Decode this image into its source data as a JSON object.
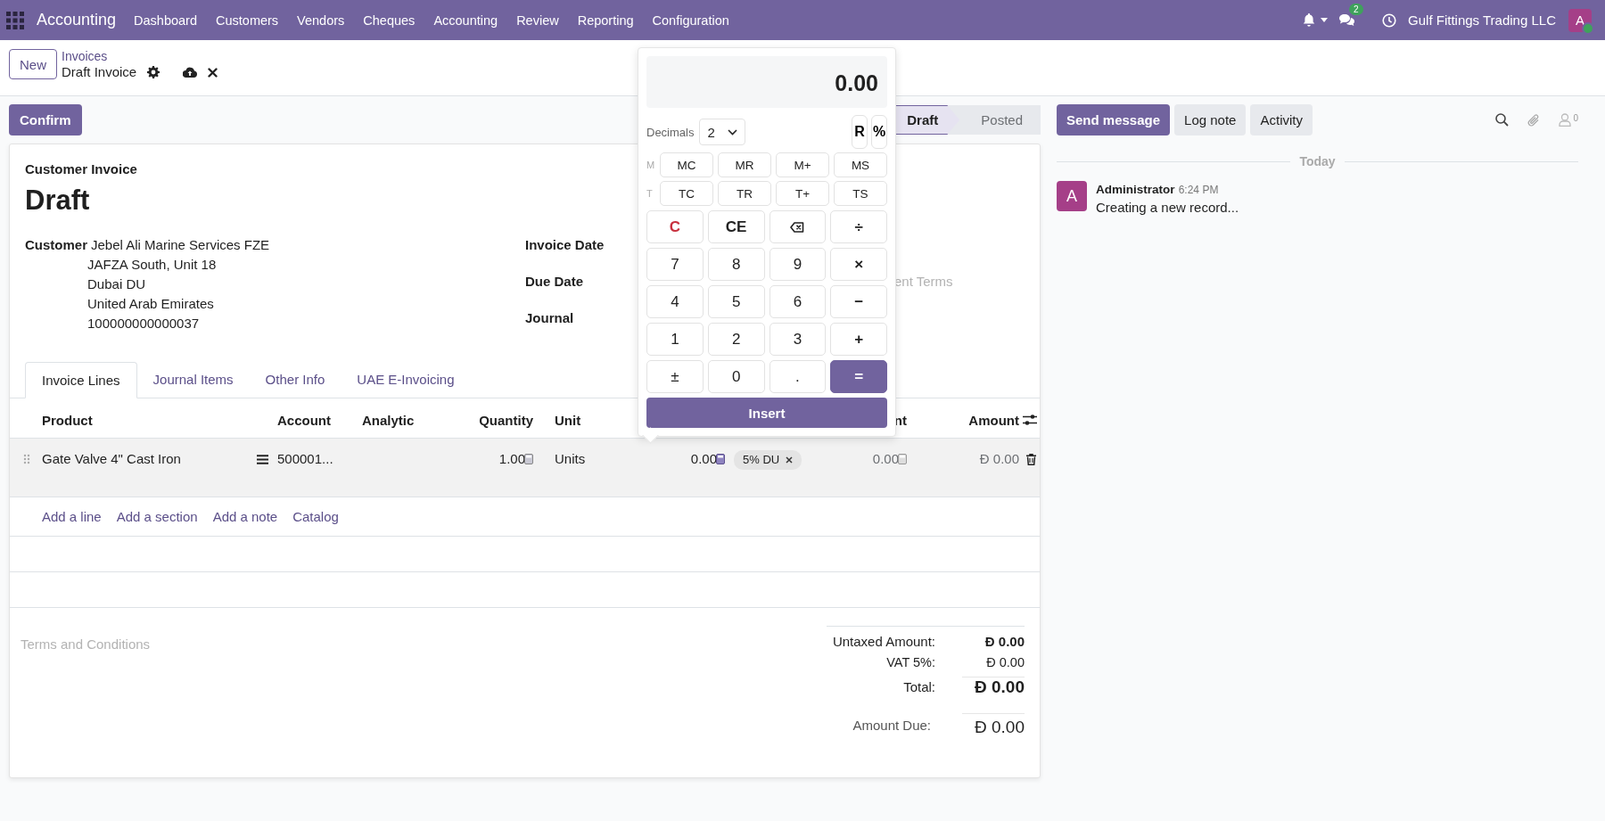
{
  "navbar": {
    "app_name": "Accounting",
    "menu": [
      "Dashboard",
      "Customers",
      "Vendors",
      "Cheques",
      "Accounting",
      "Review",
      "Reporting",
      "Configuration"
    ],
    "messages_count": "2",
    "company": "Gulf Fittings Trading LLC",
    "avatar_letter": "A"
  },
  "control_panel": {
    "new_button": "New",
    "breadcrumb": "Invoices",
    "record_title": "Draft Invoice"
  },
  "confirm_button": "Confirm",
  "status_steps": [
    {
      "label": "Draft",
      "selected": true
    },
    {
      "label": "Posted",
      "selected": false
    }
  ],
  "form": {
    "type_label": "Customer Invoice",
    "name": "Draft",
    "customer_label": "Customer",
    "customer_name": "Jebel Ali Marine Services FZE",
    "customer_address": [
      "JAFZA South, Unit 18",
      "Dubai DU",
      "United Arab Emirates",
      "100000000000037"
    ],
    "invoice_date_label": "Invoice Date",
    "due_date_label": "Due Date",
    "payment_terms_placeholder": "ent Terms",
    "journal_label": "Journal"
  },
  "tabs": [
    {
      "label": "Invoice Lines",
      "selected": true
    },
    {
      "label": "Journal Items",
      "selected": false
    },
    {
      "label": "Other Info",
      "selected": false
    },
    {
      "label": "UAE E-Invoicing",
      "selected": false
    }
  ],
  "table": {
    "columns": [
      "Product",
      "Account",
      "Analytic",
      "Quantity",
      "Unit",
      "nt",
      "Amount"
    ],
    "rows": [
      {
        "product": "Gate Valve 4\" Cast Iron",
        "account": "500001...",
        "quantity": "1.00",
        "unit": "Units",
        "price": "0.00",
        "tax": "5% DU",
        "discount": "0.00",
        "amount": "Đ 0.00"
      }
    ],
    "add_links": [
      "Add a line",
      "Add a section",
      "Add a note",
      "Catalog"
    ]
  },
  "terms_placeholder": "Terms and Conditions",
  "totals": [
    {
      "label": "Untaxed Amount:",
      "value": "Đ 0.00",
      "kind": "subtotal"
    },
    {
      "label": "VAT 5%:",
      "value": "Đ 0.00",
      "kind": "tax"
    },
    {
      "label": "Total:",
      "value": "Đ 0.00",
      "kind": "total"
    }
  ],
  "amount_due": {
    "label": "Amount Due:",
    "value": "Đ 0.00"
  },
  "chatter": {
    "buttons": [
      {
        "label": "Send message",
        "kind": "primary"
      },
      {
        "label": "Log note",
        "kind": "secondary"
      },
      {
        "label": "Activity",
        "kind": "secondary"
      }
    ],
    "followers_count": "0",
    "date_separator": "Today",
    "messages": [
      {
        "avatar_letter": "A",
        "author": "Administrator",
        "time": "6:24 PM",
        "body": "Creating a new record..."
      }
    ]
  },
  "calculator": {
    "display": "0.00",
    "decimals_label": "Decimals",
    "decimals": "2",
    "extra_keys": [
      "R",
      "%"
    ],
    "memory_label": "M",
    "memory_keys": [
      "MC",
      "MR",
      "M+",
      "MS"
    ],
    "tape_label": "T",
    "tape_keys": [
      "TC",
      "TR",
      "T+",
      "TS"
    ],
    "keys": [
      {
        "label": "C",
        "kind": "clear"
      },
      {
        "label": "CE",
        "kind": "function"
      },
      {
        "kind": "backspace"
      },
      {
        "label": "÷",
        "kind": "operator"
      },
      {
        "label": "7",
        "kind": "digit"
      },
      {
        "label": "8",
        "kind": "digit"
      },
      {
        "label": "9",
        "kind": "digit"
      },
      {
        "label": "×",
        "kind": "operator"
      },
      {
        "label": "4",
        "kind": "digit"
      },
      {
        "label": "5",
        "kind": "digit"
      },
      {
        "label": "6",
        "kind": "digit"
      },
      {
        "label": "−",
        "kind": "operator"
      },
      {
        "label": "1",
        "kind": "digit"
      },
      {
        "label": "2",
        "kind": "digit"
      },
      {
        "label": "3",
        "kind": "digit"
      },
      {
        "label": "+",
        "kind": "operator"
      },
      {
        "label": "±",
        "kind": "digit"
      },
      {
        "label": "0",
        "kind": "digit"
      },
      {
        "label": ".",
        "kind": "digit"
      },
      {
        "label": "=",
        "kind": "equals"
      }
    ],
    "insert_button": "Insert"
  }
}
